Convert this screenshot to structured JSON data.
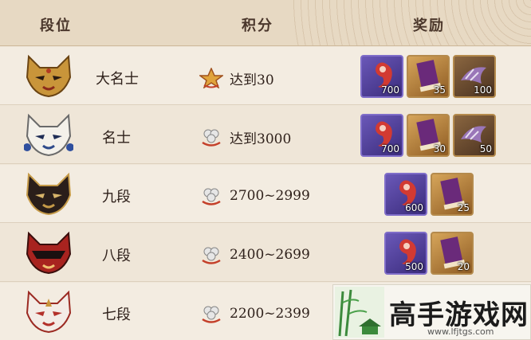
{
  "header": {
    "col_rank": "段位",
    "col_score": "积分",
    "col_reward": "奖励"
  },
  "colors": {
    "purple_frame": "#6a58b8",
    "gold_frame": "#d6a55a",
    "header_bg": "#e7d9c3"
  },
  "rows": [
    {
      "rank": "大名士",
      "mask_icon": "gold-fox-mask-icon",
      "score_icon": "star-badge-icon",
      "score": "达到30",
      "rewards": [
        {
          "icon": "red-magatama-icon",
          "qty": "700"
        },
        {
          "icon": "scroll-icon",
          "qty": "35"
        },
        {
          "icon": "claw-icon",
          "qty": "100"
        }
      ]
    },
    {
      "rank": "名士",
      "mask_icon": "blue-fox-mask-icon",
      "score_icon": "flower-badge-icon",
      "score": "达到3000",
      "rewards": [
        {
          "icon": "red-magatama-icon",
          "qty": "700"
        },
        {
          "icon": "scroll-icon",
          "qty": "30"
        },
        {
          "icon": "claw-icon",
          "qty": "50"
        }
      ]
    },
    {
      "rank": "九段",
      "mask_icon": "black-fox-mask-icon",
      "score_icon": "flower-badge-icon",
      "score": "2700~2999",
      "rewards": [
        {
          "icon": "red-magatama-icon",
          "qty": "600"
        },
        {
          "icon": "scroll-icon",
          "qty": "25"
        }
      ]
    },
    {
      "rank": "八段",
      "mask_icon": "red-black-fox-mask-icon",
      "score_icon": "flower-badge-icon",
      "score": "2400~2699",
      "rewards": [
        {
          "icon": "red-magatama-icon",
          "qty": "500"
        },
        {
          "icon": "scroll-icon",
          "qty": "20"
        }
      ]
    },
    {
      "rank": "七段",
      "mask_icon": "white-red-fox-mask-icon",
      "score_icon": "flower-badge-icon",
      "score": "2200~2399",
      "rewards": []
    }
  ],
  "watermark": {
    "title": "高手游戏网",
    "url": "www.lfjtgs.com"
  }
}
